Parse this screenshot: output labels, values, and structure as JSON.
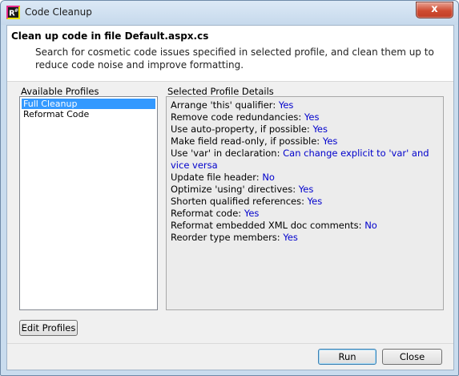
{
  "window": {
    "title": "Code Cleanup",
    "close_glyph": "x",
    "app_icon": "resharper-icon"
  },
  "header": {
    "title": "Clean up code in file Default.aspx.cs",
    "description": "Search for cosmetic code issues specified in selected profile, and clean them up to reduce code noise and improve formatting."
  },
  "profiles": {
    "label": "Available Profiles",
    "items": [
      {
        "label": "Full Cleanup",
        "selected": true
      },
      {
        "label": "Reformat Code",
        "selected": false
      }
    ]
  },
  "details": {
    "label": "Selected Profile Details",
    "rows": [
      {
        "name": "Arrange 'this' qualifier:",
        "value": "Yes"
      },
      {
        "name": "Remove code redundancies:",
        "value": "Yes"
      },
      {
        "name": "Use auto-property, if possible:",
        "value": "Yes"
      },
      {
        "name": "Make field read-only, if possible:",
        "value": "Yes"
      },
      {
        "name": "Use 'var' in declaration:",
        "value": "Can change explicit to 'var' and vice versa"
      },
      {
        "name": "Update file header:",
        "value": "No"
      },
      {
        "name": "Optimize 'using' directives:",
        "value": "Yes"
      },
      {
        "name": "Shorten qualified references:",
        "value": "Yes"
      },
      {
        "name": "Reformat code:",
        "value": "Yes"
      },
      {
        "name": "Reformat embedded XML doc comments:",
        "value": "No"
      },
      {
        "name": "Reorder type members:",
        "value": "Yes"
      }
    ]
  },
  "buttons": {
    "edit_profiles": "Edit Profiles",
    "run": "Run",
    "close": "Close"
  },
  "colors": {
    "selection": "#3399ff",
    "value_text": "#0000cc",
    "close_button": "#cf4b31"
  }
}
